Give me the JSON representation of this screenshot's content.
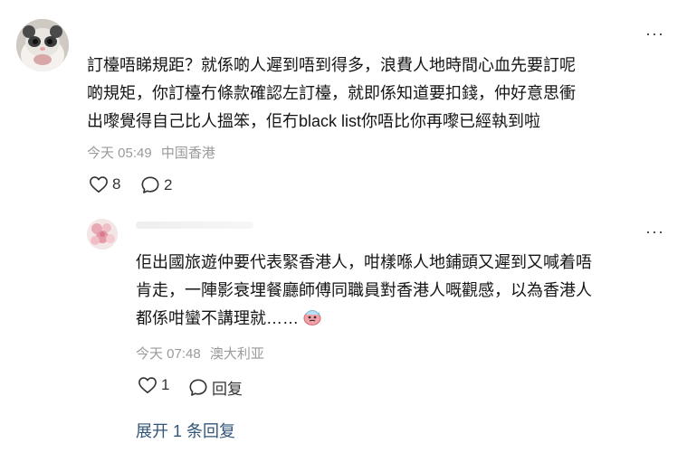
{
  "comment": {
    "text_lines": [
      "訂檯唔睇規距？就係啲人遲到唔到得多，浪費人地時間心血先要訂呢",
      "啲規矩，你訂檯冇條款確認左訂檯，就即係知道要扣錢，仲好意思衝",
      "出嚟覺得自己比人搵笨，佢冇black list你唔比你再嚟已經執到啦"
    ],
    "time": "今天 05:49",
    "location": "中国香港",
    "likes": "8",
    "comments": "2",
    "more_label": "···"
  },
  "reply": {
    "text_lines": [
      "佢出國旅遊仲要代表緊香港人，咁樣喺人地鋪頭又遲到又喊着唔",
      "肯走，一陣影衰埋餐廳師傅同職員對香港人嘅觀感，以為香港人",
      "都係咁蠻不講理就……"
    ],
    "time": "今天 07:48",
    "location": "澳大利亚",
    "likes": "1",
    "reply_label": "回复",
    "more_label": "···"
  },
  "expand_label": "展开 1 条回复",
  "icons": {
    "like": "heart-icon",
    "comment": "comment-bubble-icon",
    "emoji": "sweat-face-emoji-icon",
    "more": "more-dots-icon"
  }
}
